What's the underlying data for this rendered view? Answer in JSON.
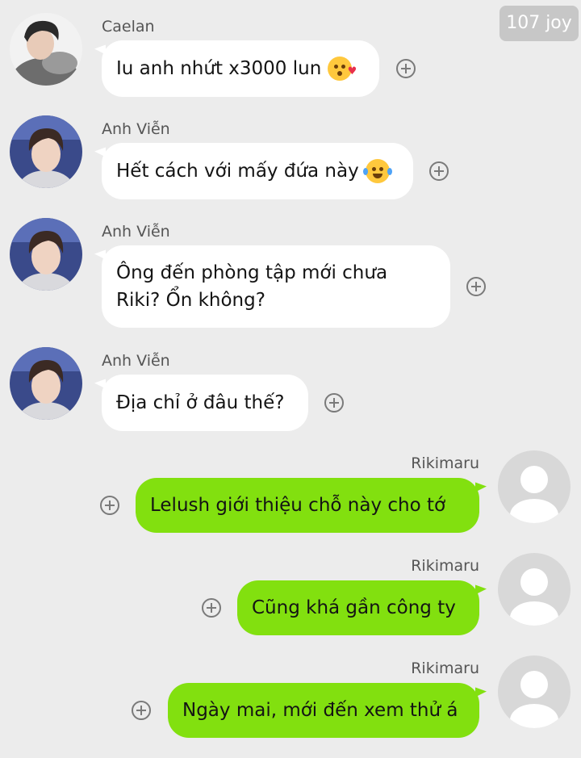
{
  "watermark": "107 joy",
  "messages": [
    {
      "sender": "Caelan",
      "text": "Iu anh nhứt x3000 lun",
      "emoji": "kissing-heart-emoji",
      "side": "left"
    },
    {
      "sender": "Anh Viễn",
      "text": "Hết cách với mấy đứa này",
      "emoji": "laughing-tears-emoji",
      "side": "left"
    },
    {
      "sender": "Anh Viễn",
      "text": "Ông đến phòng tập mới chưa Riki? Ổn không?",
      "side": "left"
    },
    {
      "sender": "Anh Viễn",
      "text": "Địa chỉ ở đâu thế?",
      "side": "left"
    },
    {
      "sender": "Rikimaru",
      "text": "Lelush giới thiệu chỗ này cho tớ",
      "side": "right"
    },
    {
      "sender": "Rikimaru",
      "text": "Cũng khá gần công ty",
      "side": "right"
    },
    {
      "sender": "Rikimaru",
      "text": "Ngày mai, mới đến xem thử á",
      "side": "right"
    }
  ],
  "colors": {
    "background": "#ececec",
    "incoming_bubble": "#ffffff",
    "outgoing_bubble": "#82e00f",
    "icon_gray": "#7a7a7a"
  },
  "icons": [
    "add-reaction-icon",
    "default-avatar-icon"
  ]
}
